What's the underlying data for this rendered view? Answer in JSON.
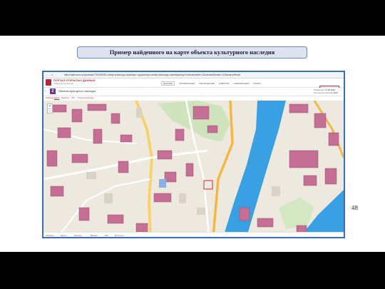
{
  "slide": {
    "title": "Пример найденного на карте объекта культурного наследия",
    "page_number": "48"
  },
  "browser": {
    "url": "https://data.mos.ru/opendata/7702155262-obekty-kulturnogo-naslediya-i-vyyavlennye-obekty-kulturnogo-naslediya/map?versionNumber=2&releaseNumber=102#searchResult"
  },
  "portal": {
    "logo_text": "ПОРТАЛ ОТКРЫТЫХ ДАННЫХ",
    "logo_subtext": "Правительства Москвы",
    "nav_items": [
      "ДАННЫЕ",
      "СПРАВОЧНИКИ",
      "ПРИЛОЖЕНИЯ",
      "НОВОСТИ",
      "ИНФОРМАЦИЯ",
      "ПОИСК"
    ],
    "search_button": "Расширенный",
    "lang": "EN"
  },
  "dataset": {
    "number": "2",
    "title": "Объекты культурного наследия",
    "updated_label": "Обновлено:",
    "updated_value": "17.06.2016",
    "records_label": "Количество записей:",
    "records_value": "8207"
  },
  "tabs": [
    "Таблица",
    "Карта",
    "Паспорт",
    "API",
    "Получить Ссылку"
  ],
  "footer_links": [
    "Таблица",
    "Карта",
    "Паспорт",
    "Версии",
    "API",
    "Получить"
  ],
  "icons": {
    "logo": "portal-logo-icon",
    "back": "arrow-left-icon",
    "zoom_in": "plus-icon",
    "zoom_out": "minus-icon",
    "highlight": "selection-marker-icon"
  },
  "colors": {
    "accent": "#b0283c",
    "frame": "#3a6cc4",
    "river": "#3aa0e4",
    "building": "#c56f94"
  }
}
